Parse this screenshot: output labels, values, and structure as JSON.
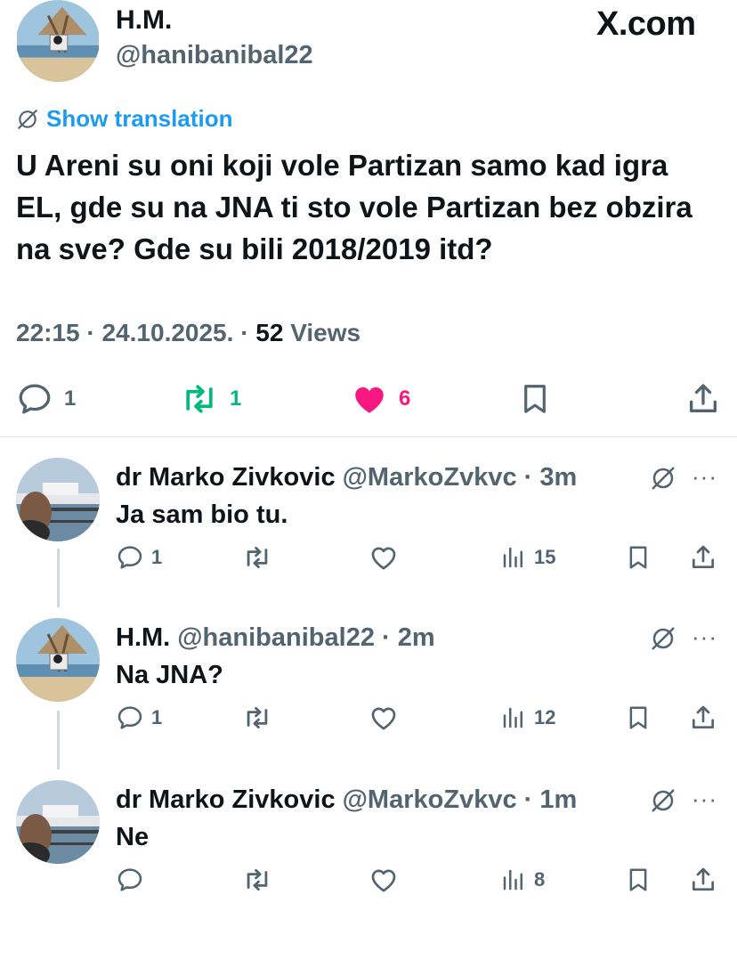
{
  "colors": {
    "accent": "#1d9bf0",
    "retweet": "#00ba7c",
    "like": "#f91880",
    "secondary": "#536471",
    "primary": "#0f1419"
  },
  "main_tweet": {
    "author_name": "H.M.",
    "author_handle": "@hanibanibal22",
    "brand": "X.com",
    "translate_label": "Show translation",
    "text": "U Areni su oni koji vole Partizan samo kad igra EL, gde su na JNA ti sto vole Partizan bez obzira na sve? Gde su bili 2018/2019 itd?",
    "time": "22:15 · 24.10.2025. · ",
    "views_count": "52",
    "views_label": " Views",
    "replies": "1",
    "retweets": "1",
    "likes": "6",
    "icons": [
      "globe-slash-icon",
      "reply-icon",
      "retweet-icon",
      "heart-filled-icon",
      "bookmark-icon",
      "share-icon"
    ]
  },
  "replies": [
    {
      "author_name": "dr Marko Zivkovic",
      "author_handle": "@MarkoZvkvc",
      "time": "3m",
      "text": "Ja sam bio tu.",
      "replies": "1",
      "retweets": "",
      "likes": "",
      "views": "15"
    },
    {
      "author_name": "H.M.",
      "author_handle": "@hanibanibal22",
      "time": "2m",
      "text": "Na JNA?",
      "replies": "1",
      "retweets": "",
      "likes": "",
      "views": "12"
    },
    {
      "author_name": "dr Marko Zivkovic",
      "author_handle": "@MarkoZvkvc",
      "time": "1m",
      "text": "Ne",
      "replies": "",
      "retweets": "",
      "likes": "",
      "views": "8"
    }
  ],
  "dot_separator": " · ",
  "more_label": "···"
}
